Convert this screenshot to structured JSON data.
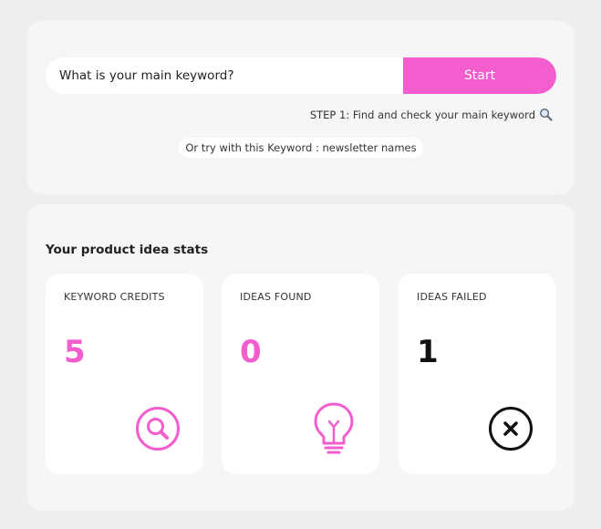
{
  "search": {
    "placeholder": "What is your main keyword?",
    "button_label": "Start"
  },
  "step_hint": "STEP 1: Find and check your main keyword",
  "suggestion": "Or try with this Keyword : newsletter names",
  "stats": {
    "title": "Your product idea stats",
    "cards": [
      {
        "label": "KEYWORD CREDITS",
        "value": "5",
        "icon": "search-icon",
        "color": "#f35dcd"
      },
      {
        "label": "IDEAS FOUND",
        "value": "0",
        "icon": "lightbulb-icon",
        "color": "#f35dcd"
      },
      {
        "label": "IDEAS FAILED",
        "value": "1",
        "icon": "close-circle-icon",
        "color": "#111111"
      }
    ]
  },
  "colors": {
    "accent": "#f35dcd",
    "background": "#efeeee",
    "panel": "#f7f6f6"
  }
}
